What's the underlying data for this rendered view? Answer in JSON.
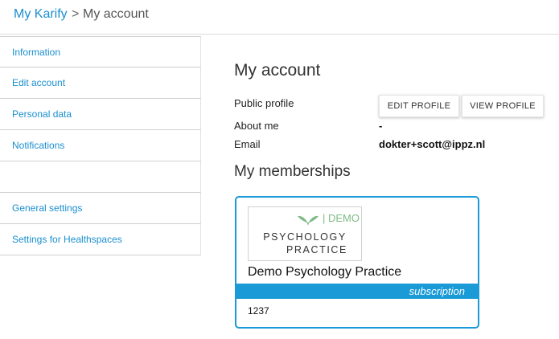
{
  "breadcrumb": {
    "home": "My Karify",
    "separator": ">",
    "current": "My account"
  },
  "sidebar": {
    "items": [
      {
        "label": "Information"
      },
      {
        "label": "Edit account"
      },
      {
        "label": "Personal data"
      },
      {
        "label": "Notifications"
      },
      {
        "label": ""
      },
      {
        "label": "General settings"
      },
      {
        "label": "Settings for Healthspaces"
      }
    ]
  },
  "account": {
    "title": "My account",
    "public_profile_label": "Public profile",
    "edit_profile_button": "EDIT PROFILE",
    "view_profile_button": "VIEW PROFILE",
    "about_me_label": "About me",
    "about_me_value": "-",
    "email_label": "Email",
    "email_value": "dokter+scott@ippz.nl"
  },
  "memberships": {
    "title": "My memberships",
    "cards": [
      {
        "logo_demo": "| DEMO",
        "logo_line1": "PSYCHOLOGY",
        "logo_line2": "PRACTICE",
        "name": "Demo Psychology Practice",
        "type": "subscription",
        "id": "1237"
      }
    ]
  },
  "colors": {
    "accent": "#1a9ad6",
    "link": "#1a8fd0",
    "logo_green": "#7dbb86"
  }
}
